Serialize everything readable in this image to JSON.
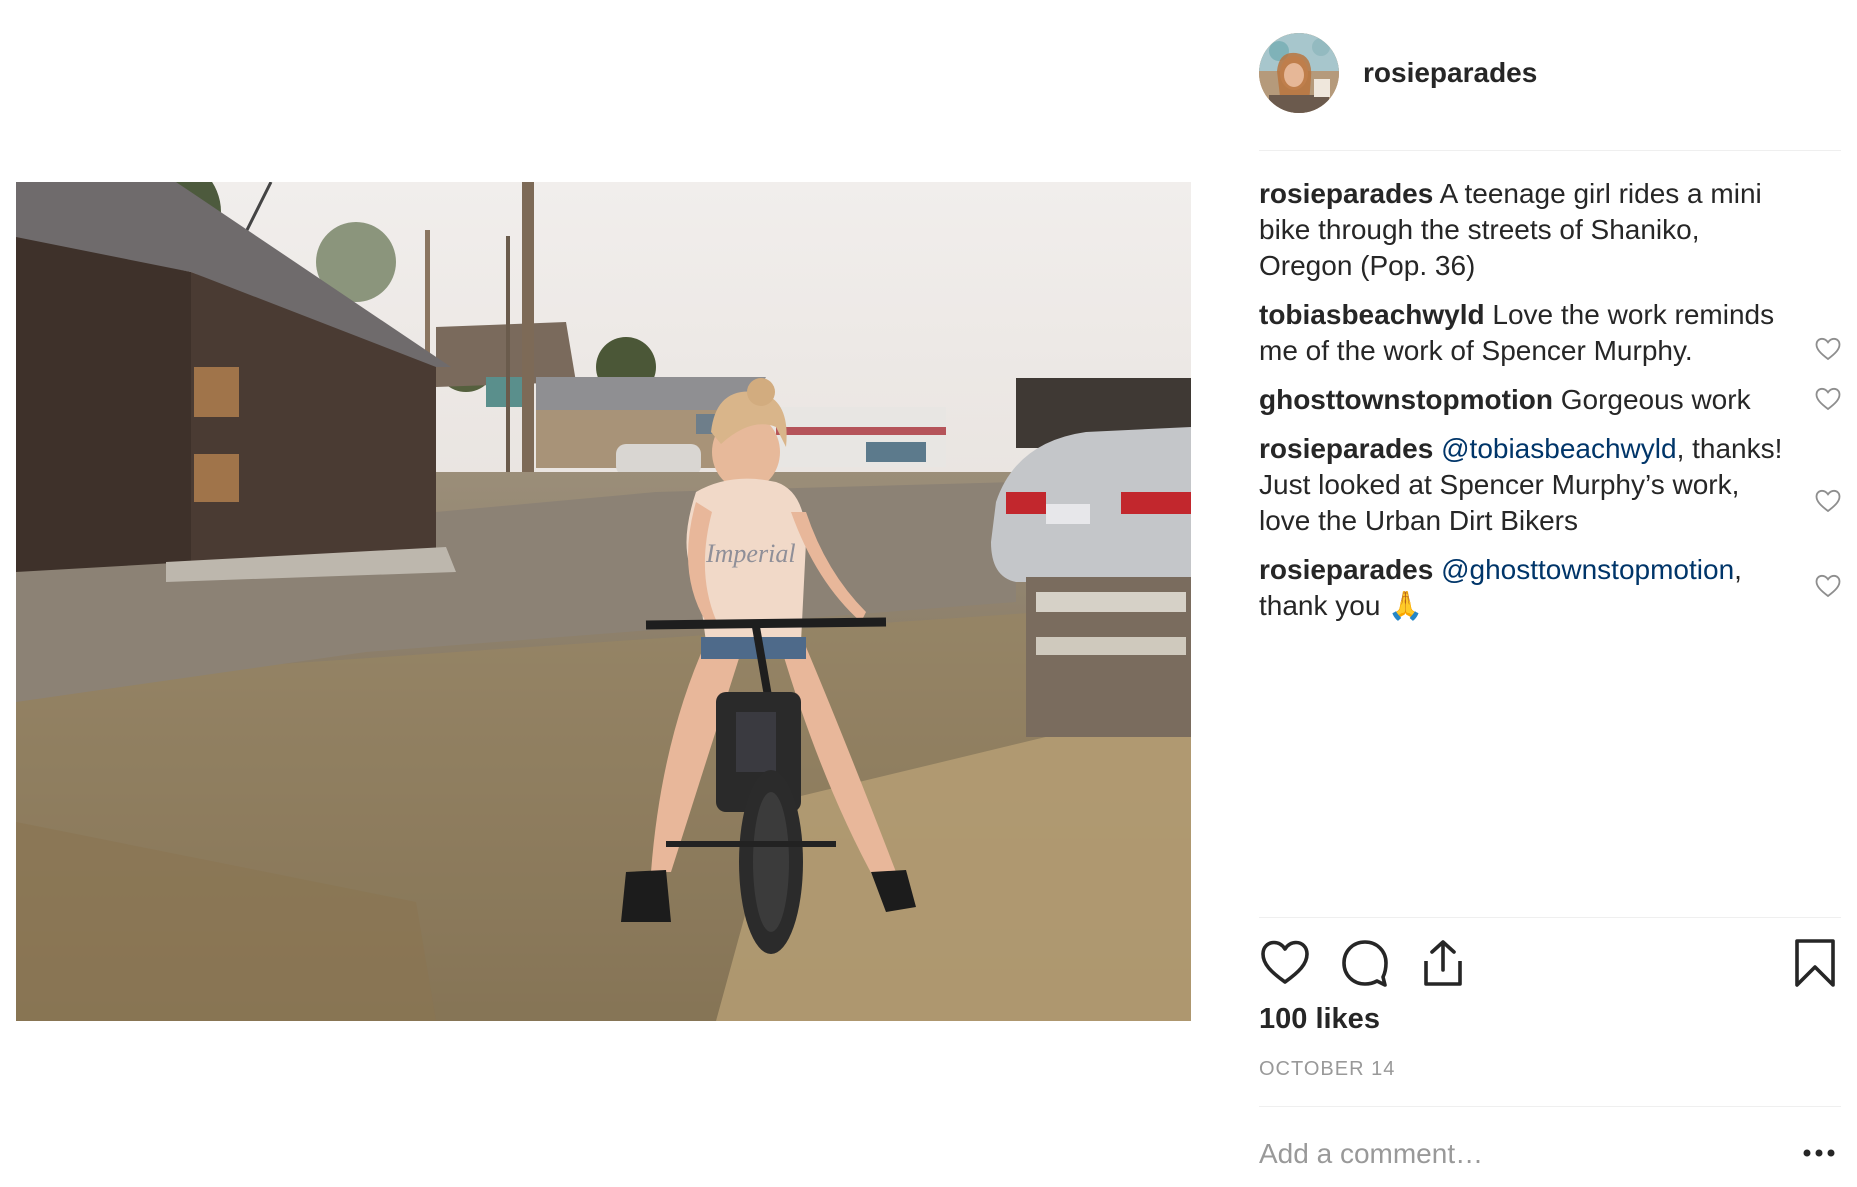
{
  "post": {
    "author": "rosieparades",
    "caption": {
      "user": "rosieparades",
      "text": "A teenage girl rides a mini bike through the streets of Shaniko, Oregon (Pop. 36)"
    },
    "comments": [
      {
        "user": "tobiasbeachwyld",
        "mention": "",
        "text": "Love the work reminds me of the work of Spencer Murphy."
      },
      {
        "user": "ghosttownstopmotion",
        "mention": "",
        "text": "Gorgeous work"
      },
      {
        "user": "rosieparades",
        "mention": "@tobiasbeachwyld",
        "text": ", thanks! Just looked at Spencer Murphy’s work, love the Urban Dirt Bikers"
      },
      {
        "user": "rosieparades",
        "mention": "@ghosttownstopmotion",
        "text": ", thank you 🙏"
      }
    ],
    "likes": "100 likes",
    "date": "OCTOBER 14",
    "add_comment_placeholder": "Add a comment…",
    "icons": {
      "like": "heart-icon",
      "comment": "comment-bubble-icon",
      "share": "share-upload-icon",
      "save": "bookmark-icon",
      "more": "ellipsis-icon",
      "comment_like": "heart-outline-icon"
    },
    "colors": {
      "text": "#262626",
      "mention": "#003569",
      "muted": "#999999",
      "divider": "#efefef"
    }
  }
}
